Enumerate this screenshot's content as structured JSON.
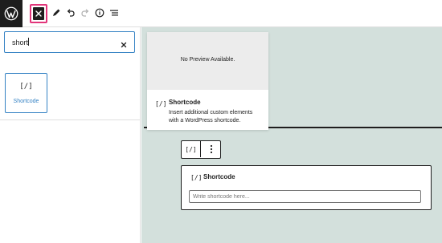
{
  "toolbar": {
    "logo_icon": "wordpress-logo-icon",
    "close_icon": "close-icon",
    "close_symbol": "×",
    "edit_icon": "pencil-icon",
    "undo_icon": "undo-icon",
    "redo_icon": "redo-icon",
    "info_icon": "info-icon",
    "list_view_icon": "list-view-icon",
    "highlight_color": "#e2357a"
  },
  "inserter": {
    "search_value": "short",
    "clear_symbol": "×",
    "results": [
      {
        "icon": "[/]",
        "label": "Shortcode"
      }
    ]
  },
  "preview": {
    "placeholder": "No Preview Available.",
    "icon": "[/]",
    "title": "Shortcode",
    "description": "Insert additional custom elements with a WordPress shortcode."
  },
  "canvas": {
    "background": "#d3e0dc",
    "block_toolbar": {
      "icon": "[/]",
      "more_icon": "more-vertical-icon"
    },
    "shortcode_block": {
      "icon": "[/]",
      "title": "Shortcode",
      "input_placeholder": "Write shortcode here..."
    }
  }
}
